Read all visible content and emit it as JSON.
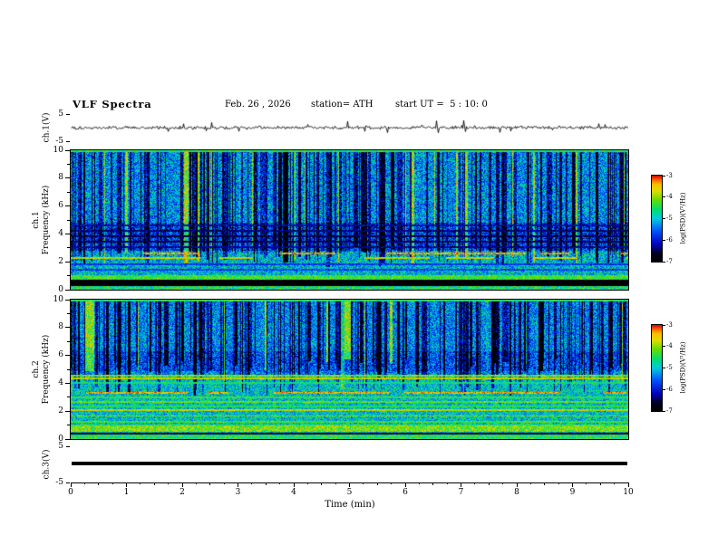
{
  "header": {
    "title": "VLF Spectra",
    "date": "Feb. 26 , 2026",
    "station": "station= ATH",
    "start_ut": "start UT =  5 : 10: 0"
  },
  "xaxis": {
    "label": "Time (min)",
    "min": 0,
    "max": 10,
    "major_ticks": [
      "0",
      "1",
      "2",
      "3",
      "4",
      "5",
      "6",
      "7",
      "8",
      "9",
      "10"
    ]
  },
  "panels": {
    "ch1_wave": {
      "ylabel": "ch.1(V)",
      "ytick_top": "5",
      "ytick_bottom": "-5"
    },
    "ch1_spec": {
      "ylabel_channel": "ch.1",
      "ylabel_axis": "Frequency (kHz)",
      "yticks": [
        "0",
        "2",
        "4",
        "6",
        "8",
        "10"
      ]
    },
    "ch2_spec": {
      "ylabel_channel": "ch.2",
      "ylabel_axis": "Frequency (kHz)",
      "yticks": [
        "0",
        "2",
        "4",
        "6",
        "8",
        "10"
      ]
    },
    "ch3_wave": {
      "ylabel": "ch.3(V)",
      "ytick_top": "5",
      "ytick_bottom": "-5"
    }
  },
  "colorbars": {
    "label": "log(PSD)(V²/Hz)",
    "ticks": [
      "-3",
      "-4",
      "-5",
      "-6",
      "-7"
    ],
    "vmax": -3,
    "vmin": -7
  },
  "chart_data": [
    {
      "id": "wave1",
      "type": "line",
      "title": "ch.1 (V) waveform",
      "xlim": [
        0,
        10
      ],
      "ylim": [
        -5,
        5
      ],
      "summary": "dense broadband noise centred on 0 V, typical excursions about ±1-2 V with impulsive spikes to roughly ±4 V over the full 10 minutes",
      "render": {
        "seed": 101,
        "amp": 2.2,
        "spikeProb": 0.06,
        "spikeAmp": 14
      }
    },
    {
      "id": "spec1",
      "type": "heatmap",
      "title": "ch.1 VLF spectrogram",
      "xlim_min": [
        0,
        10
      ],
      "flim_khz": [
        0,
        10
      ],
      "zlim_logpsd": [
        -7,
        -3
      ],
      "summary": "cyan/green background noise near -5 with dense dark-blue vertical sferic streaks above ~2.5 kHz, darker horizontal band 3-4.8 kHz, reddish dashed hum lines near 2.2-2.6 kHz, bright green band 0.7-1 kHz, solid black band 0.3-0.7 kHz, green speckle at the bottom edge",
      "render": {
        "seed": 42,
        "hiBase": -5.3,
        "lowBase": -5.05,
        "lowSplit": 2.7,
        "noise": 1.5,
        "streakProb": 0.45,
        "streakMinF": 2.3,
        "brightProb": 0.07,
        "darkRegion": [
          2.8,
          4.8,
          0.45
        ],
        "bands": [
          {
            "f": [
              9.85,
              10.01
            ],
            "level": -4.5,
            "var": 0.6
          },
          {
            "f": [
              4.55,
              4.68
            ],
            "level": -6.2,
            "var": 0.4
          },
          {
            "f": [
              4.18,
              4.3
            ],
            "level": -6.4,
            "var": 0.4
          },
          {
            "f": [
              3.78,
              3.9
            ],
            "level": -6.5,
            "var": 0.4
          },
          {
            "f": [
              3.38,
              3.5
            ],
            "level": -6.5,
            "var": 0.4
          },
          {
            "f": [
              3.0,
              3.12
            ],
            "level": -6.3,
            "var": 0.4
          },
          {
            "f": [
              2.52,
              2.65
            ],
            "level": -3.4,
            "var": 0.4,
            "dash": 0.5
          },
          {
            "f": [
              2.18,
              2.32
            ],
            "level": -3.8,
            "var": 0.5,
            "dash": 0.55
          },
          {
            "f": [
              1.78,
              1.9
            ],
            "level": -5.8,
            "var": 0.4
          },
          {
            "f": [
              1.38,
              1.5
            ],
            "level": -5.7,
            "var": 0.4
          },
          {
            "f": [
              0.72,
              1.05
            ],
            "level": -4.35,
            "var": 0.5
          },
          {
            "f": [
              0.28,
              0.72
            ],
            "level": -6.95,
            "var": 0.12
          },
          {
            "f": [
              0.0,
              0.28
            ],
            "level": -4.6,
            "var": 0.7
          }
        ]
      }
    },
    {
      "id": "spec2",
      "type": "heatmap",
      "title": "ch.2 VLF spectrogram",
      "xlim_min": [
        0,
        10
      ],
      "flim_khz": [
        0,
        10
      ],
      "zlim_logpsd": [
        -7,
        -3
      ],
      "summary": "similar sferic streaks above ~4.5 kHz; below that a greener background with many yellow/green horizontal hum lines (strong yellow near 2 and 4.4 kHz, reddish dashed near 3.3 kHz), bright yellow-green band 0.5-0.95 kHz and a thin dark line near 0.35 kHz",
      "render": {
        "seed": 1337,
        "hiBase": -5.35,
        "lowBase": -4.95,
        "lowSplit": 4.6,
        "noise": 1.4,
        "streakProb": 0.42,
        "streakMinF": 4.4,
        "brightProb": 0.06,
        "darkRegion": [
          4.9,
          6.3,
          0.3
        ],
        "bands": [
          {
            "f": [
              9.85,
              10.01
            ],
            "level": -4.5,
            "var": 0.6
          },
          {
            "f": [
              4.5,
              4.62
            ],
            "level": -4.0,
            "var": 0.5
          },
          {
            "f": [
              4.3,
              4.42
            ],
            "level": -3.8,
            "var": 0.5
          },
          {
            "f": [
              3.95,
              4.07
            ],
            "level": -4.6,
            "var": 0.5
          },
          {
            "f": [
              3.25,
              3.38
            ],
            "level": -3.5,
            "var": 0.5,
            "dash": 0.6
          },
          {
            "f": [
              2.95,
              3.06
            ],
            "level": -4.4,
            "var": 0.4
          },
          {
            "f": [
              2.6,
              2.72
            ],
            "level": -4.2,
            "var": 0.4
          },
          {
            "f": [
              2.28,
              2.4
            ],
            "level": -4.5,
            "var": 0.4
          },
          {
            "f": [
              2.0,
              2.14
            ],
            "level": -3.8,
            "var": 0.5
          },
          {
            "f": [
              1.6,
              1.72
            ],
            "level": -4.1,
            "var": 0.4
          },
          {
            "f": [
              1.18,
              1.3
            ],
            "level": -4.3,
            "var": 0.4
          },
          {
            "f": [
              0.95,
              1.07
            ],
            "level": -4.4,
            "var": 0.4
          },
          {
            "f": [
              0.5,
              0.95
            ],
            "level": -4.1,
            "var": 0.6
          },
          {
            "f": [
              0.3,
              0.44
            ],
            "level": -6.6,
            "var": 0.5
          },
          {
            "f": [
              0.0,
              0.3
            ],
            "level": -4.5,
            "var": 0.6
          }
        ]
      }
    },
    {
      "id": "wave3",
      "type": "line",
      "title": "ch.3 (V) waveform",
      "xlim": [
        0,
        10
      ],
      "ylim": [
        -5,
        5
      ],
      "summary": "constant flat line at 0 V (thick black trace, no signal)"
    }
  ],
  "render": {
    "colormap": [
      [
        0.0,
        "#000000"
      ],
      [
        0.09,
        "#00001a"
      ],
      [
        0.2,
        "#0000bb"
      ],
      [
        0.36,
        "#0055ff"
      ],
      [
        0.5,
        "#00ccdd"
      ],
      [
        0.6,
        "#00dd77"
      ],
      [
        0.72,
        "#66dd00"
      ],
      [
        0.82,
        "#dddd00"
      ],
      [
        0.9,
        "#ffbb00"
      ],
      [
        0.95,
        "#ff6600"
      ],
      [
        1.0,
        "#cc0000"
      ]
    ]
  }
}
